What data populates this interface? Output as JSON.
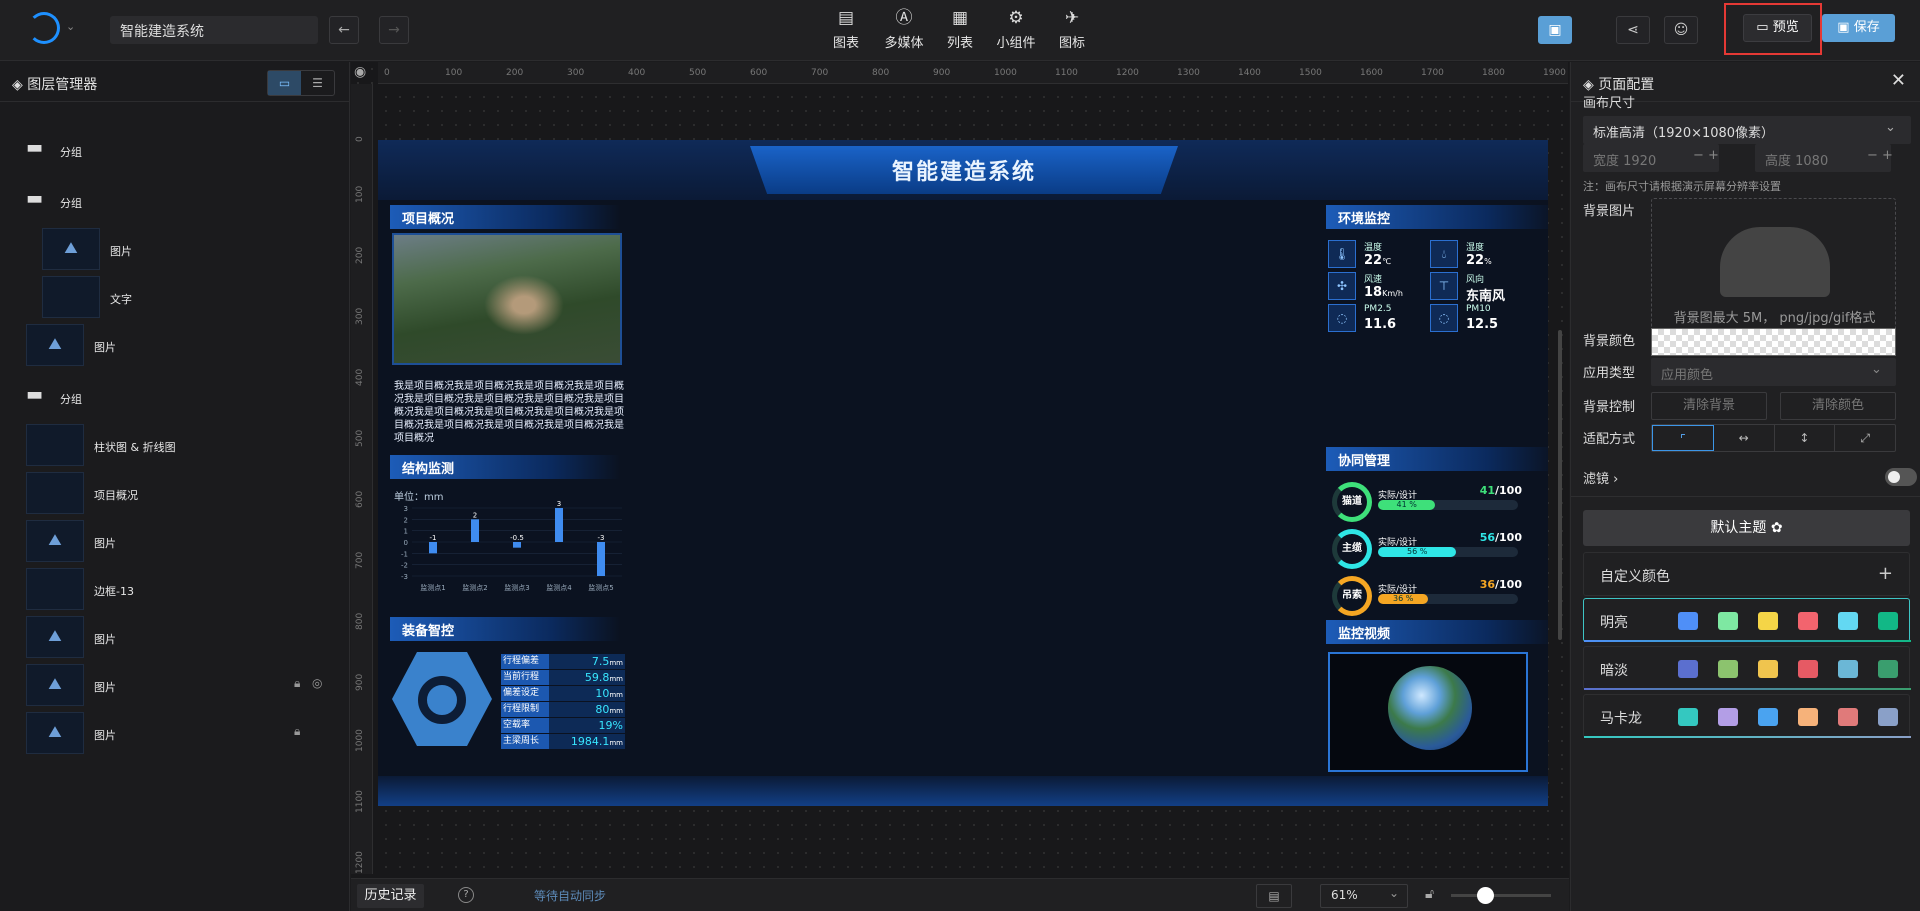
{
  "app": {
    "project_name": "智能建造系统"
  },
  "toolbar": {
    "tools": [
      "图表",
      "多媒体",
      "列表",
      "小组件",
      "图标"
    ],
    "preview_label": "预览",
    "save_label": "保存"
  },
  "layers": {
    "title": "图层管理器",
    "items": [
      {
        "label": "分组",
        "kind": "folder"
      },
      {
        "label": "分组",
        "kind": "folder"
      },
      {
        "label": "图片",
        "kind": "image"
      },
      {
        "label": "文字",
        "kind": "text"
      },
      {
        "label": "图片",
        "kind": "image"
      },
      {
        "label": "分组",
        "kind": "folder"
      },
      {
        "label": "柱状图 & 折线图",
        "kind": "chart"
      },
      {
        "label": "项目概况",
        "kind": "text"
      },
      {
        "label": "图片",
        "kind": "image"
      },
      {
        "label": "边框-13",
        "kind": "border"
      },
      {
        "label": "图片",
        "kind": "image"
      },
      {
        "label": "图片",
        "kind": "image",
        "locked": true,
        "hidden": true
      },
      {
        "label": "图片",
        "kind": "image",
        "locked": true
      }
    ]
  },
  "ruler": {
    "top": [
      "0",
      "100",
      "200",
      "300",
      "400",
      "500",
      "600",
      "700",
      "800",
      "900",
      "1000",
      "1100",
      "1200",
      "1300",
      "1400",
      "1500",
      "1600",
      "1700",
      "1800",
      "1900"
    ],
    "left": [
      "0",
      "100",
      "200",
      "300",
      "400",
      "500",
      "600",
      "700",
      "800",
      "900",
      "1000",
      "1100",
      "1200"
    ]
  },
  "dashboard": {
    "title": "智能建造系统",
    "overview": {
      "title": "项目概况",
      "text": "我是项目概况我是项目概况我是项目概况我是项目概况我是项目概况我是项目概况我是项目概况我是项目概况我是项目概况我是项目概况我是项目概况我是项目概况我是项目概况我是项目概况我是项目概况我是项目概况"
    },
    "structure": {
      "title": "结构监测",
      "unit": "单位：mm"
    },
    "equipment": {
      "title": "装备智控",
      "rows": [
        {
          "k": "行程偏差",
          "v": "7.5",
          "u": "mm"
        },
        {
          "k": "当前行程",
          "v": "59.8",
          "u": "mm"
        },
        {
          "k": "偏差设定",
          "v": "10",
          "u": "mm"
        },
        {
          "k": "行程限制",
          "v": "80",
          "u": "mm"
        },
        {
          "k": "空载率",
          "v": "19%",
          "u": ""
        },
        {
          "k": "主梁周长",
          "v": "1984.1",
          "u": "mm"
        }
      ]
    },
    "env": {
      "title": "环境监控",
      "items": [
        {
          "name": "温度",
          "value": "22",
          "unit": "℃"
        },
        {
          "name": "湿度",
          "value": "22",
          "unit": "%"
        },
        {
          "name": "风速",
          "value": "18",
          "unit": "Km/h"
        },
        {
          "name": "风向",
          "value": "东南风",
          "unit": ""
        },
        {
          "name": "PM2.5",
          "value": "11.6",
          "unit": ""
        },
        {
          "name": "PM10",
          "value": "12.5",
          "unit": ""
        }
      ]
    },
    "coop": {
      "title": "协同管理",
      "items": [
        {
          "name": "猫道",
          "label": "实际/设计",
          "actual": "41",
          "design": "/100",
          "pct": "41 %",
          "ratio": 0.41,
          "color": "#3ee07a"
        },
        {
          "name": "主缆",
          "label": "实际/设计",
          "actual": "56",
          "design": "/100",
          "pct": "56 %",
          "ratio": 0.56,
          "color": "#2fe6e6"
        },
        {
          "name": "吊索",
          "label": "实际/设计",
          "actual": "36",
          "design": "/100",
          "pct": "36 %",
          "ratio": 0.36,
          "color": "#f5a623"
        }
      ]
    },
    "video": {
      "title": "监控视频"
    }
  },
  "chart_data": {
    "type": "bar",
    "categories": [
      "监测点1",
      "监测点2",
      "监测点3",
      "监测点4",
      "监测点5"
    ],
    "values": [
      -1,
      2,
      -0.5,
      3,
      -3
    ],
    "ylim": [
      -3,
      3
    ],
    "yticks": [
      "3",
      "2",
      "1",
      "0",
      "-1",
      "-2",
      "-3"
    ],
    "ylabel": "单位：mm",
    "color": "#3f8cf0"
  },
  "bottom": {
    "history": "历史记录",
    "sync": "等待自动同步",
    "zoom": "61%"
  },
  "config": {
    "title": "页面配置",
    "canvas_size_label": "画布尺寸",
    "canvas_size_value": "标准高清（1920×1080像素）",
    "width_label": "宽度 1920",
    "height_label": "高度 1080",
    "note": "注：画布尺寸请根据演示屏幕分辨率设置",
    "bg_image_label": "背景图片",
    "bg_upload_hint": "背景图最大 5M， png/jpg/gif格式",
    "bg_color_label": "背景颜色",
    "apply_type_label": "应用类型",
    "apply_type_value": "应用颜色",
    "bg_control_label": "背景控制",
    "clear_bg": "清除背景",
    "clear_color": "清除颜色",
    "fit_label": "适配方式",
    "filter_label": "滤镜",
    "default_theme": "默认主题",
    "custom_color": "自定义颜色",
    "palettes": [
      {
        "name": "明亮",
        "colors": [
          "#4f8ff7",
          "#7ee8a2",
          "#f5d547",
          "#f2646e",
          "#63d8f2",
          "#12b886"
        ],
        "underline": "linear-gradient(90deg,#4f8ff7,#12b886)"
      },
      {
        "name": "暗淡",
        "colors": [
          "#5b6fcf",
          "#8cc36e",
          "#f0c44e",
          "#e65a64",
          "#6bb7d6",
          "#3a9e6e"
        ],
        "underline": "linear-gradient(90deg,#5b6fcf,#3a9e6e)"
      },
      {
        "name": "马卡龙",
        "colors": [
          "#34c8c0",
          "#b39ee6",
          "#4aa3f0",
          "#f6b27a",
          "#e07a7a",
          "#8aa0c8"
        ],
        "underline": "linear-gradient(90deg,#34c8c0,#8aa0c8)"
      }
    ]
  }
}
